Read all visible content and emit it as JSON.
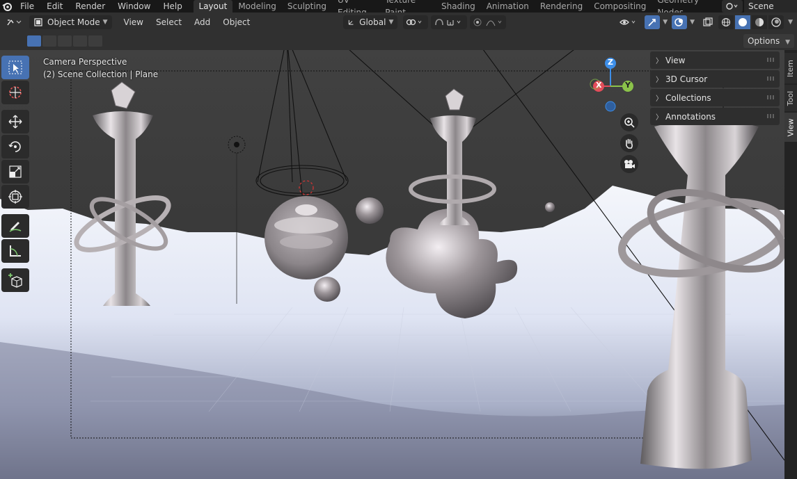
{
  "topbar": {
    "menus": [
      "File",
      "Edit",
      "Render",
      "Window",
      "Help"
    ],
    "workspace_tabs": [
      "Layout",
      "Modeling",
      "Sculpting",
      "UV Editing",
      "Texture Paint",
      "Shading",
      "Animation",
      "Rendering",
      "Compositing",
      "Geometry Nodes"
    ],
    "active_tab": "Layout",
    "scene_name": "Scene"
  },
  "header": {
    "mode": "Object Mode",
    "menus": [
      "View",
      "Select",
      "Add",
      "Object"
    ],
    "transform_orientation": "Global"
  },
  "toolrow": {
    "options_label": "Options"
  },
  "viewport": {
    "camera_label": "Camera Perspective",
    "collection_label": "(2) Scene Collection | Plane",
    "gizmo_axes": {
      "x": "X",
      "y": "Y",
      "z": "Z"
    }
  },
  "npanel": {
    "sections": [
      "View",
      "3D Cursor",
      "Collections",
      "Annotations"
    ]
  },
  "sidebar_tabs": [
    "Item",
    "Tool",
    "View"
  ],
  "colors": {
    "accent": "#4772b3",
    "axis_x": "#e44d5a",
    "axis_y": "#8bc34a",
    "axis_z": "#3d8ee8"
  },
  "icons": [
    "blender-logo-icon",
    "editor-type-icon",
    "object-mode-icon",
    "select-box-icon",
    "cursor-icon",
    "move-icon",
    "rotate-icon",
    "scale-icon",
    "transform-icon",
    "annotate-icon",
    "measure-icon",
    "add-cube-icon",
    "zoom-icon",
    "hand-icon",
    "camera-icon"
  ]
}
